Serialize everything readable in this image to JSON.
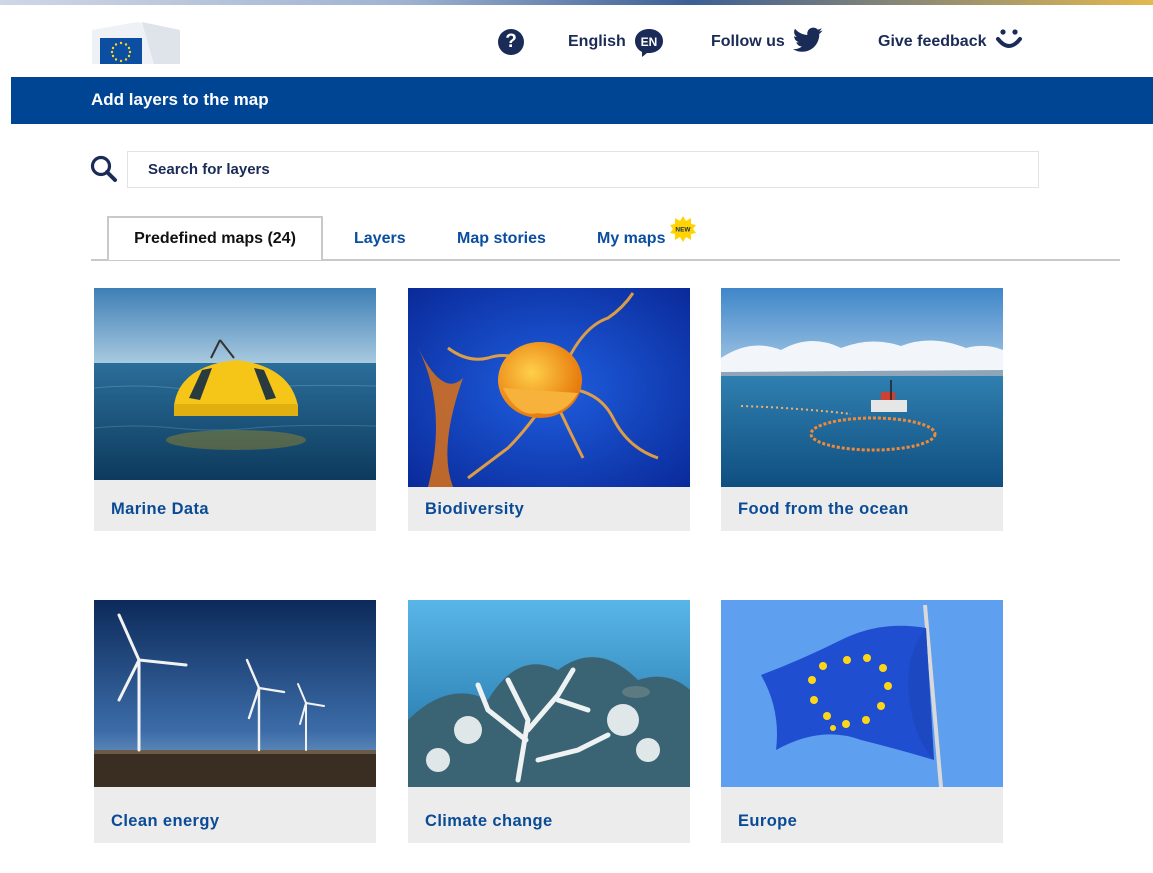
{
  "header": {
    "language_label": "English",
    "language_code": "EN",
    "follow_label": "Follow us",
    "feedback_label": "Give feedback"
  },
  "title_bar": {
    "title": "Add layers to the map"
  },
  "search": {
    "placeholder": "Search for layers"
  },
  "tabs": [
    {
      "label": "Predefined maps (24)",
      "active": true
    },
    {
      "label": "Layers"
    },
    {
      "label": "Map stories"
    },
    {
      "label": "My maps",
      "badge": "NEW"
    }
  ],
  "cards": [
    {
      "label": "Marine Data"
    },
    {
      "label": "Biodiversity"
    },
    {
      "label": "Food from the ocean"
    },
    {
      "label": "Clean energy"
    },
    {
      "label": "Climate change"
    },
    {
      "label": "Europe"
    }
  ],
  "colors": {
    "brand_blue": "#004494",
    "link_blue": "#0a4b96",
    "eu_yellow": "#ffd617"
  },
  "icons": [
    "eu-flag-logo-icon",
    "help-icon",
    "language-bubble-icon",
    "twitter-bird-icon",
    "smiley-icon",
    "search-icon",
    "new-burst-icon"
  ]
}
